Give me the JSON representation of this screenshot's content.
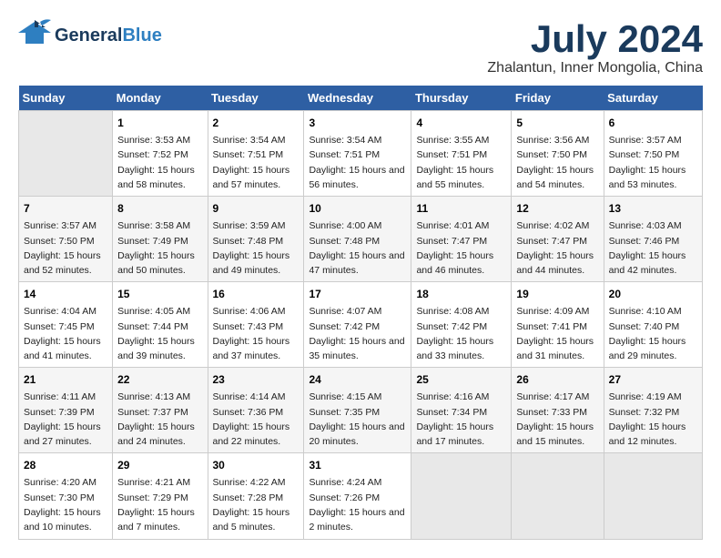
{
  "header": {
    "logo_line1": "General",
    "logo_line2": "Blue",
    "title": "July 2024",
    "subtitle": "Zhalantun, Inner Mongolia, China"
  },
  "calendar": {
    "days_of_week": [
      "Sunday",
      "Monday",
      "Tuesday",
      "Wednesday",
      "Thursday",
      "Friday",
      "Saturday"
    ],
    "weeks": [
      [
        {
          "date": "",
          "sunrise": "",
          "sunset": "",
          "daylight": ""
        },
        {
          "date": "1",
          "sunrise": "Sunrise: 3:53 AM",
          "sunset": "Sunset: 7:52 PM",
          "daylight": "Daylight: 15 hours and 58 minutes."
        },
        {
          "date": "2",
          "sunrise": "Sunrise: 3:54 AM",
          "sunset": "Sunset: 7:51 PM",
          "daylight": "Daylight: 15 hours and 57 minutes."
        },
        {
          "date": "3",
          "sunrise": "Sunrise: 3:54 AM",
          "sunset": "Sunset: 7:51 PM",
          "daylight": "Daylight: 15 hours and 56 minutes."
        },
        {
          "date": "4",
          "sunrise": "Sunrise: 3:55 AM",
          "sunset": "Sunset: 7:51 PM",
          "daylight": "Daylight: 15 hours and 55 minutes."
        },
        {
          "date": "5",
          "sunrise": "Sunrise: 3:56 AM",
          "sunset": "Sunset: 7:50 PM",
          "daylight": "Daylight: 15 hours and 54 minutes."
        },
        {
          "date": "6",
          "sunrise": "Sunrise: 3:57 AM",
          "sunset": "Sunset: 7:50 PM",
          "daylight": "Daylight: 15 hours and 53 minutes."
        }
      ],
      [
        {
          "date": "7",
          "sunrise": "Sunrise: 3:57 AM",
          "sunset": "Sunset: 7:50 PM",
          "daylight": "Daylight: 15 hours and 52 minutes."
        },
        {
          "date": "8",
          "sunrise": "Sunrise: 3:58 AM",
          "sunset": "Sunset: 7:49 PM",
          "daylight": "Daylight: 15 hours and 50 minutes."
        },
        {
          "date": "9",
          "sunrise": "Sunrise: 3:59 AM",
          "sunset": "Sunset: 7:48 PM",
          "daylight": "Daylight: 15 hours and 49 minutes."
        },
        {
          "date": "10",
          "sunrise": "Sunrise: 4:00 AM",
          "sunset": "Sunset: 7:48 PM",
          "daylight": "Daylight: 15 hours and 47 minutes."
        },
        {
          "date": "11",
          "sunrise": "Sunrise: 4:01 AM",
          "sunset": "Sunset: 7:47 PM",
          "daylight": "Daylight: 15 hours and 46 minutes."
        },
        {
          "date": "12",
          "sunrise": "Sunrise: 4:02 AM",
          "sunset": "Sunset: 7:47 PM",
          "daylight": "Daylight: 15 hours and 44 minutes."
        },
        {
          "date": "13",
          "sunrise": "Sunrise: 4:03 AM",
          "sunset": "Sunset: 7:46 PM",
          "daylight": "Daylight: 15 hours and 42 minutes."
        }
      ],
      [
        {
          "date": "14",
          "sunrise": "Sunrise: 4:04 AM",
          "sunset": "Sunset: 7:45 PM",
          "daylight": "Daylight: 15 hours and 41 minutes."
        },
        {
          "date": "15",
          "sunrise": "Sunrise: 4:05 AM",
          "sunset": "Sunset: 7:44 PM",
          "daylight": "Daylight: 15 hours and 39 minutes."
        },
        {
          "date": "16",
          "sunrise": "Sunrise: 4:06 AM",
          "sunset": "Sunset: 7:43 PM",
          "daylight": "Daylight: 15 hours and 37 minutes."
        },
        {
          "date": "17",
          "sunrise": "Sunrise: 4:07 AM",
          "sunset": "Sunset: 7:42 PM",
          "daylight": "Daylight: 15 hours and 35 minutes."
        },
        {
          "date": "18",
          "sunrise": "Sunrise: 4:08 AM",
          "sunset": "Sunset: 7:42 PM",
          "daylight": "Daylight: 15 hours and 33 minutes."
        },
        {
          "date": "19",
          "sunrise": "Sunrise: 4:09 AM",
          "sunset": "Sunset: 7:41 PM",
          "daylight": "Daylight: 15 hours and 31 minutes."
        },
        {
          "date": "20",
          "sunrise": "Sunrise: 4:10 AM",
          "sunset": "Sunset: 7:40 PM",
          "daylight": "Daylight: 15 hours and 29 minutes."
        }
      ],
      [
        {
          "date": "21",
          "sunrise": "Sunrise: 4:11 AM",
          "sunset": "Sunset: 7:39 PM",
          "daylight": "Daylight: 15 hours and 27 minutes."
        },
        {
          "date": "22",
          "sunrise": "Sunrise: 4:13 AM",
          "sunset": "Sunset: 7:37 PM",
          "daylight": "Daylight: 15 hours and 24 minutes."
        },
        {
          "date": "23",
          "sunrise": "Sunrise: 4:14 AM",
          "sunset": "Sunset: 7:36 PM",
          "daylight": "Daylight: 15 hours and 22 minutes."
        },
        {
          "date": "24",
          "sunrise": "Sunrise: 4:15 AM",
          "sunset": "Sunset: 7:35 PM",
          "daylight": "Daylight: 15 hours and 20 minutes."
        },
        {
          "date": "25",
          "sunrise": "Sunrise: 4:16 AM",
          "sunset": "Sunset: 7:34 PM",
          "daylight": "Daylight: 15 hours and 17 minutes."
        },
        {
          "date": "26",
          "sunrise": "Sunrise: 4:17 AM",
          "sunset": "Sunset: 7:33 PM",
          "daylight": "Daylight: 15 hours and 15 minutes."
        },
        {
          "date": "27",
          "sunrise": "Sunrise: 4:19 AM",
          "sunset": "Sunset: 7:32 PM",
          "daylight": "Daylight: 15 hours and 12 minutes."
        }
      ],
      [
        {
          "date": "28",
          "sunrise": "Sunrise: 4:20 AM",
          "sunset": "Sunset: 7:30 PM",
          "daylight": "Daylight: 15 hours and 10 minutes."
        },
        {
          "date": "29",
          "sunrise": "Sunrise: 4:21 AM",
          "sunset": "Sunset: 7:29 PM",
          "daylight": "Daylight: 15 hours and 7 minutes."
        },
        {
          "date": "30",
          "sunrise": "Sunrise: 4:22 AM",
          "sunset": "Sunset: 7:28 PM",
          "daylight": "Daylight: 15 hours and 5 minutes."
        },
        {
          "date": "31",
          "sunrise": "Sunrise: 4:24 AM",
          "sunset": "Sunset: 7:26 PM",
          "daylight": "Daylight: 15 hours and 2 minutes."
        },
        {
          "date": "",
          "sunrise": "",
          "sunset": "",
          "daylight": ""
        },
        {
          "date": "",
          "sunrise": "",
          "sunset": "",
          "daylight": ""
        },
        {
          "date": "",
          "sunrise": "",
          "sunset": "",
          "daylight": ""
        }
      ]
    ]
  }
}
